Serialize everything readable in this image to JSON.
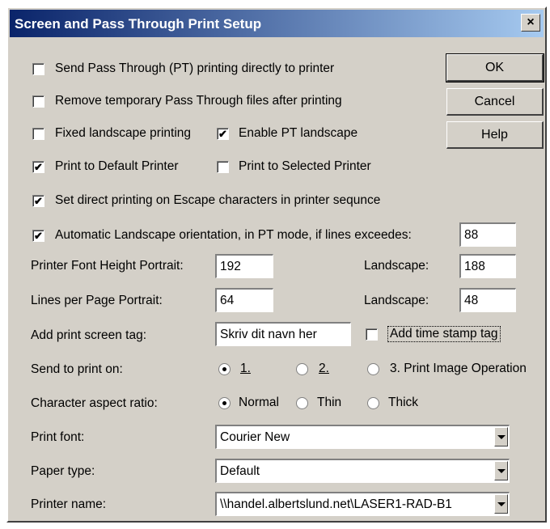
{
  "dialog": {
    "title": "Screen and Pass Through Print Setup",
    "close_glyph": "×"
  },
  "buttons": {
    "ok": "OK",
    "cancel": "Cancel",
    "help": "Help"
  },
  "options": {
    "send_pt_direct": {
      "label": "Send Pass Through (PT) printing directly to printer",
      "checked": false
    },
    "remove_temp": {
      "label": "Remove temporary Pass Through files after printing",
      "checked": false
    },
    "fixed_landscape": {
      "label": "Fixed landscape printing",
      "checked": false
    },
    "enable_pt_landscape": {
      "label": "Enable PT landscape",
      "checked": true
    },
    "print_default": {
      "label": "Print to Default Printer",
      "checked": true
    },
    "print_selected": {
      "label": "Print to Selected Printer",
      "checked": false
    },
    "escape_chars": {
      "label": "Set direct printing on Escape characters in printer sequnce",
      "checked": true
    },
    "auto_landscape": {
      "label": "Automatic Landscape orientation, in PT mode, if lines exceedes:",
      "checked": true,
      "value": "88"
    }
  },
  "fields": {
    "font_height_label": "Printer Font Height Portrait:",
    "font_height_portrait": "192",
    "font_height_landscape_label": "Landscape:",
    "font_height_landscape": "188",
    "lines_label": "Lines per Page Portrait:",
    "lines_portrait": "64",
    "lines_landscape_label": "Landscape:",
    "lines_landscape": "48",
    "tag_label": "Add print screen tag:",
    "tag_value": "Skriv dit navn her",
    "timestamp_label": "Add time stamp tag",
    "timestamp_checked": false
  },
  "send_to": {
    "label": "Send to print on:",
    "options": [
      "1.",
      "2.",
      "3. Print Image Operation"
    ],
    "selected": 0
  },
  "aspect": {
    "label": "Character aspect ratio:",
    "options": [
      "Normal",
      "Thin",
      "Thick"
    ],
    "selected": 0
  },
  "combos": {
    "font_label": "Print font:",
    "font_value": "Courier New",
    "paper_label": "Paper type:",
    "paper_value": "Default",
    "printer_label": "Printer name:",
    "printer_value": "\\\\handel.albertslund.net\\LASER1-RAD-B1"
  }
}
